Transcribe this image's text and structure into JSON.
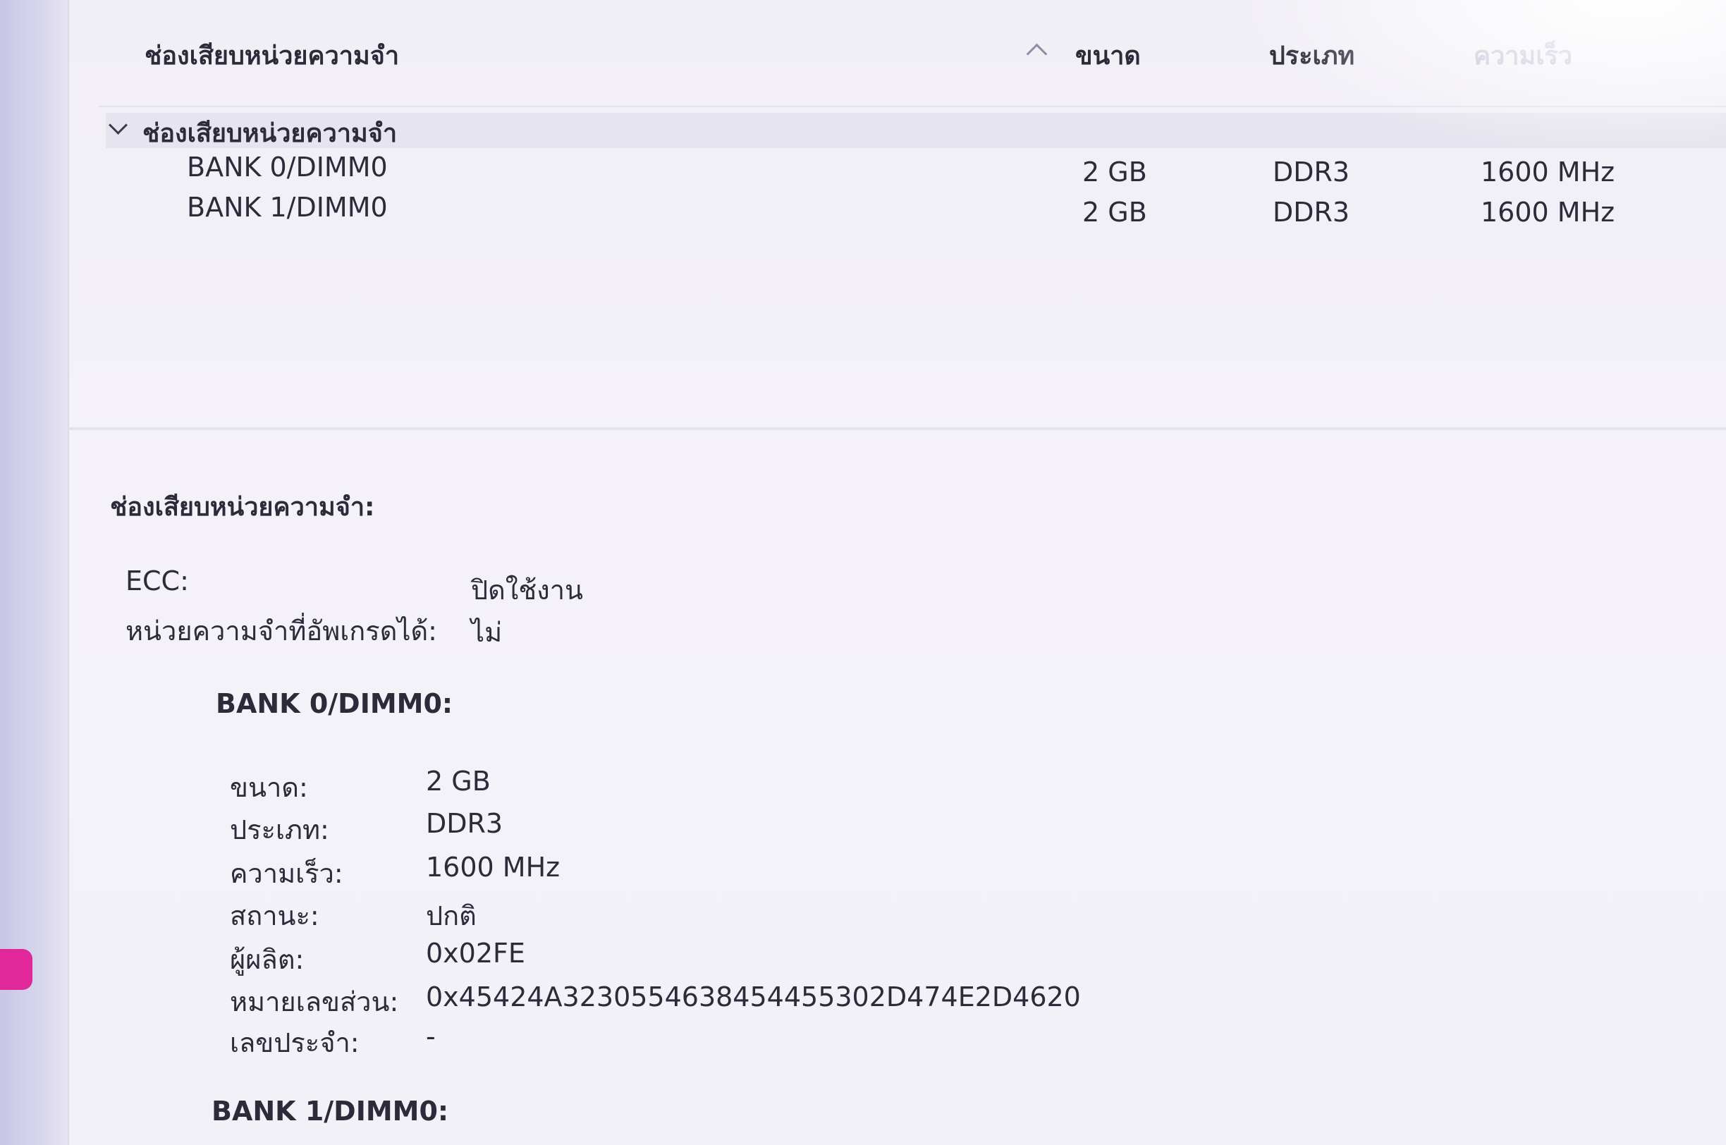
{
  "list": {
    "columns": {
      "name": "ช่องเสียบหน่วยความจำ",
      "size": "ขนาด",
      "type": "ประเภท",
      "speed": "ความเร็ว"
    },
    "group_label": "ช่องเสียบหน่วยความจำ",
    "rows": [
      {
        "name": "BANK 0/DIMM0",
        "size": "2 GB",
        "type": "DDR3",
        "speed": "1600 MHz"
      },
      {
        "name": "BANK 1/DIMM0",
        "size": "2 GB",
        "type": "DDR3",
        "speed": "1600 MHz"
      }
    ]
  },
  "detail": {
    "section_title": "ช่องเสียบหน่วยความจำ:",
    "summary": [
      {
        "label": "ECC:",
        "value": "ปิดใช้งาน"
      },
      {
        "label": "หน่วยความจำที่อัพเกรดได้:",
        "value": "ไม่"
      }
    ],
    "banks": [
      {
        "title": "BANK 0/DIMM0:",
        "fields": [
          {
            "label": "ขนาด:",
            "value": "2 GB"
          },
          {
            "label": "ประเภท:",
            "value": "DDR3"
          },
          {
            "label": "ความเร็ว:",
            "value": "1600 MHz"
          },
          {
            "label": "สถานะ:",
            "value": "ปกติ"
          },
          {
            "label": "ผู้ผลิต:",
            "value": "0x02FE"
          },
          {
            "label": "หมายเลขส่วน:",
            "value": "0x45424A3230554638454455302D474E2D4620"
          },
          {
            "label": "เลขประจำ:",
            "value": "-"
          }
        ]
      },
      {
        "title": "BANK 1/DIMM0:"
      }
    ]
  },
  "colors": {
    "accent": "#e0289a",
    "sidebar": "#d2cfea",
    "text": "#2b2b3a",
    "muted_header": "#b9b6cf"
  }
}
